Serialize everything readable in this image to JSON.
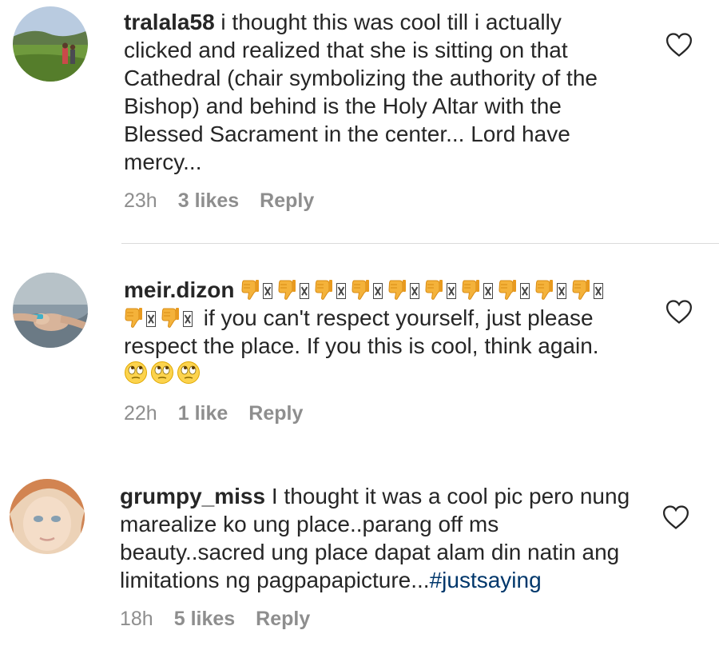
{
  "comments": [
    {
      "username": "tralala58",
      "text": "i thought this was cool till i actually clicked and realized that she is sitting on that Cathedral (chair symbolizing the authority of the Bishop) and behind is the Holy Altar with the Blessed Sacrament in the center... Lord have mercy...",
      "time": "23h",
      "likes": "3 likes",
      "reply": "Reply",
      "avatar_icon": "landscape-avatar",
      "like_icon": "heart-outline-icon"
    },
    {
      "username": "meir.dizon",
      "text": "if you can't respect yourself, just please respect the place. If you this is cool, think again.",
      "leading_emoji": "thumbs-down-icon",
      "leading_emoji_count": 12,
      "trailing_emoji": "rolling-eyes-icon",
      "trailing_emoji_count": 3,
      "time": "22h",
      "likes": "1 like",
      "reply": "Reply",
      "avatar_icon": "holding-hands-avatar",
      "like_icon": "heart-outline-icon"
    },
    {
      "username": "grumpy_miss",
      "text": "I thought it was a cool pic pero nung marealize ko ung place..parang off ms beauty..sacred ung place dapat alam din natin ang limitations ng pagpapapicture...",
      "hashtag": "#justsaying",
      "time": "18h",
      "likes": "5 likes",
      "reply": "Reply",
      "avatar_icon": "face-portrait-avatar",
      "like_icon": "heart-outline-icon"
    }
  ],
  "colors": {
    "text": "#262626",
    "meta": "#8e8e8e",
    "hashtag": "#00376b",
    "divider": "#dbdbdb"
  }
}
